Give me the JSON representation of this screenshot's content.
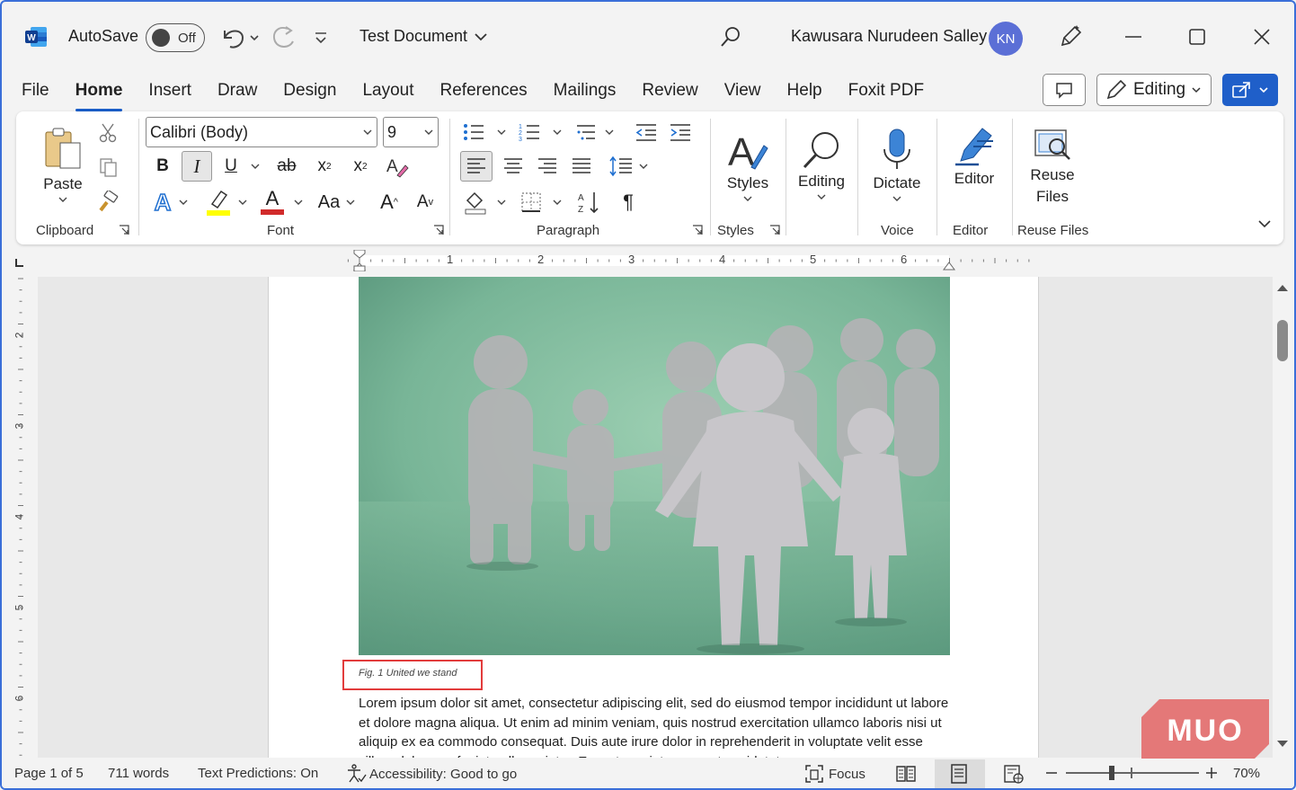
{
  "titlebar": {
    "autosave_label": "AutoSave",
    "autosave_state": "Off",
    "doc_title": "Test Document",
    "user_name": "Kawusara Nurudeen Salley",
    "user_initials": "KN"
  },
  "tabs": [
    "File",
    "Home",
    "Insert",
    "Draw",
    "Design",
    "Layout",
    "References",
    "Mailings",
    "Review",
    "View",
    "Help",
    "Foxit PDF"
  ],
  "active_tab": "Home",
  "mode_button": "Editing",
  "ribbon": {
    "clipboard": {
      "paste": "Paste",
      "group": "Clipboard"
    },
    "font": {
      "family": "Calibri (Body)",
      "size": "9",
      "group": "Font",
      "bold": "B",
      "italic": "I",
      "underline": "U",
      "strike": "ab",
      "subscript": "x",
      "superscript": "x",
      "case": "Aa",
      "grow": "A",
      "shrink": "A",
      "text_effect": "A",
      "font_color": "A"
    },
    "paragraph": {
      "group": "Paragraph"
    },
    "styles": {
      "label": "Styles",
      "group": "Styles"
    },
    "editing": {
      "label": "Editing"
    },
    "voice": {
      "label": "Dictate",
      "group": "Voice"
    },
    "editor": {
      "label": "Editor",
      "group": "Editor"
    },
    "reuse": {
      "label_line1": "Reuse",
      "label_line2": "Files",
      "group": "Reuse Files"
    }
  },
  "ruler": {
    "h_numbers": [
      "1",
      "2",
      "3",
      "4",
      "5",
      "6"
    ],
    "v_numbers": [
      "2",
      "3",
      "4",
      "5",
      "6"
    ]
  },
  "document": {
    "caption": "Fig. 1 United we stand",
    "body": "Lorem ipsum dolor sit amet, consectetur adipiscing elit, sed do eiusmod tempor incididunt ut labore et dolore magna aliqua. Ut enim ad minim veniam, quis nostrud exercitation ullamco laboris nisi ut aliquip ex ea commodo consequat. Duis aute irure dolor in reprehenderit in voluptate velit esse cillum dolore eu fugiat nulla pariatur. Excepteur sint occaecat cupidatat"
  },
  "watermark": "MUO",
  "status": {
    "page": "Page 1 of 5",
    "words": "711 words",
    "predictions": "Text Predictions: On",
    "accessibility": "Accessibility: Good to go",
    "focus": "Focus",
    "zoom": "70%"
  },
  "colors": {
    "accent": "#1f5fc9",
    "avatar": "#5b6fd6",
    "caption_outline": "#e23c3c",
    "highlight": "#ffff00",
    "font_color": "#d12b2b",
    "watermark": "#e36e6e"
  },
  "icons": [
    "word-logo-icon",
    "undo-icon",
    "redo-icon",
    "search-icon",
    "pen-icon",
    "minimize-icon",
    "maximize-icon",
    "close-icon",
    "comment-icon",
    "share-icon",
    "paste-icon",
    "cut-icon",
    "copy-icon",
    "format-painter-icon",
    "microphone-icon",
    "magnifier-icon"
  ]
}
